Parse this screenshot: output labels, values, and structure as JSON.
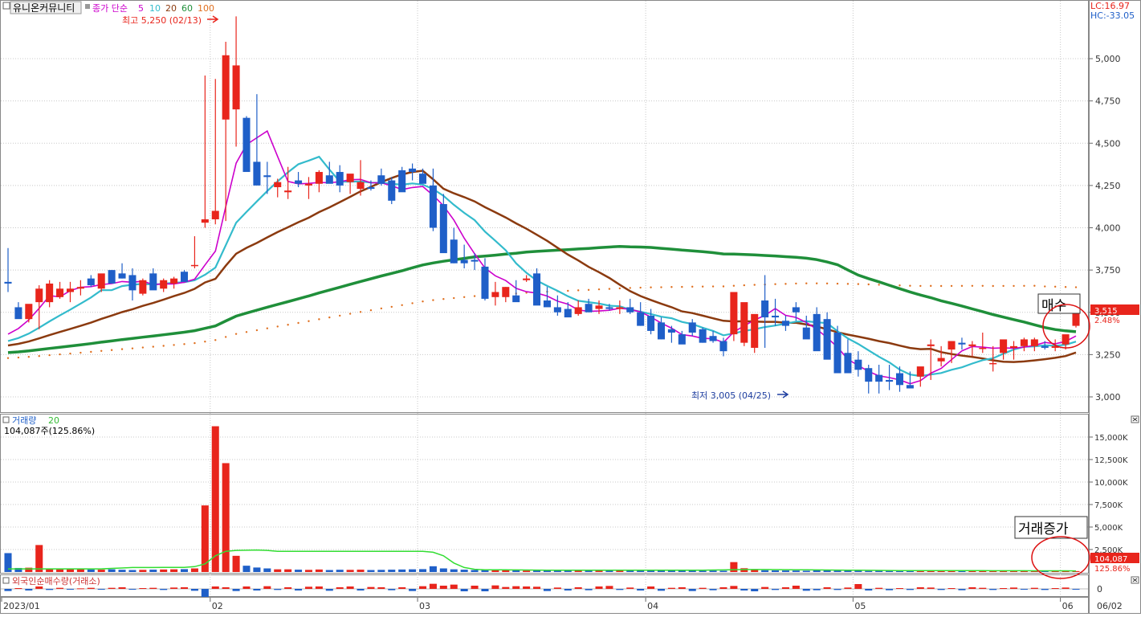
{
  "stock_name": "유니온커뮤니티",
  "price_panel": {
    "indicator_label": "종가 단순",
    "ma_periods": [
      {
        "label": "5",
        "color": "#cc00cc"
      },
      {
        "label": "10",
        "color": "#33bbcc"
      },
      {
        "label": "20",
        "color": "#8b3a0f"
      },
      {
        "label": "60",
        "color": "#1f8f3a"
      },
      {
        "label": "100",
        "color": "#e07020"
      }
    ],
    "lc_label": "LC:16.97",
    "hc_label": "HC:-33.05",
    "high_annotation": "최고 5,250 (02/13)",
    "low_annotation": "최저 3,005 (04/25)",
    "current_price": "3,515",
    "current_change": "2.48%",
    "buy_label": "매수",
    "y_ticks": [
      "5,000",
      "4,750",
      "4,500",
      "4,250",
      "4,000",
      "3,750",
      "3,500",
      "3,250",
      "3,000"
    ]
  },
  "volume_panel": {
    "title": "거래량",
    "ma_label": "20",
    "info": "104,087주(125.86%)",
    "current_volume": "104,087",
    "current_ratio": "125.86%",
    "increase_label": "거래증가",
    "y_ticks": [
      "15,000K",
      "12,500K",
      "10,000K",
      "7,500K",
      "5,000K",
      "2,500K"
    ]
  },
  "foreign_panel": {
    "title": "외국인순매수량(거래소)",
    "zero_tick": "0"
  },
  "x_axis": {
    "labels": [
      "2023/01",
      "02",
      "03",
      "04",
      "05",
      "06"
    ],
    "last_date": "06/02"
  },
  "colors": {
    "up": "#e8251c",
    "down": "#1f5fc8",
    "vol_ma": "#33dd33",
    "grid": "#c8c8c8",
    "axis_text": "#333333"
  },
  "chart_data": {
    "type": "candlestick",
    "dates": [
      "01/02",
      "01/03",
      "01/04",
      "01/05",
      "01/06",
      "01/09",
      "01/10",
      "01/11",
      "01/12",
      "01/13",
      "01/16",
      "01/17",
      "01/18",
      "01/19",
      "01/20",
      "01/25",
      "01/26",
      "01/27",
      "01/30",
      "01/31",
      "02/01",
      "02/02",
      "02/03",
      "02/06",
      "02/07",
      "02/08",
      "02/09",
      "02/10",
      "02/13",
      "02/14",
      "02/15",
      "02/16",
      "02/17",
      "02/20",
      "02/21",
      "02/22",
      "02/23",
      "02/24",
      "02/27",
      "02/28",
      "03/02",
      "03/03",
      "03/06",
      "03/07",
      "03/08",
      "03/09",
      "03/10",
      "03/13",
      "03/14",
      "03/15",
      "03/16",
      "03/17",
      "03/20",
      "03/21",
      "03/22",
      "03/23",
      "03/24",
      "03/27",
      "03/28",
      "03/29",
      "03/30",
      "03/31",
      "04/03",
      "04/04",
      "04/05",
      "04/06",
      "04/07",
      "04/10",
      "04/11",
      "04/12",
      "04/13",
      "04/14",
      "04/17",
      "04/18",
      "04/19",
      "04/20",
      "04/21",
      "04/24",
      "04/25",
      "04/26",
      "04/27",
      "04/28",
      "05/02",
      "05/03",
      "05/04",
      "05/08",
      "05/09",
      "05/10",
      "05/11",
      "05/12",
      "05/15",
      "05/16",
      "05/17",
      "05/18",
      "05/19",
      "05/22",
      "05/23",
      "05/24",
      "05/25",
      "05/26",
      "05/30",
      "05/31",
      "06/01",
      "06/02"
    ],
    "open": [
      3680,
      3530,
      3460,
      3560,
      3560,
      3590,
      3620,
      3640,
      3700,
      3640,
      3750,
      3730,
      3720,
      3610,
      3730,
      3640,
      3670,
      3740,
      3780,
      4030,
      4050,
      4640,
      4700,
      4650,
      4390,
      4310,
      4240,
      4210,
      4280,
      4250,
      4260,
      4310,
      4330,
      4270,
      4230,
      4240,
      4310,
      4280,
      4340,
      4350,
      4320,
      4250,
      4140,
      3930,
      3810,
      3810,
      3770,
      3590,
      3590,
      3600,
      3690,
      3730,
      3570,
      3530,
      3520,
      3490,
      3550,
      3520,
      3530,
      3520,
      3530,
      3500,
      3480,
      3440,
      3400,
      3370,
      3440,
      3400,
      3360,
      3330,
      3370,
      3320,
      3290,
      3570,
      3480,
      3450,
      3530,
      3410,
      3490,
      3460,
      3380,
      3260,
      3220,
      3170,
      3130,
      3100,
      3140,
      3070,
      3120,
      3300,
      3210,
      3280,
      3320,
      3300,
      3290,
      3200,
      3260,
      3290,
      3300,
      3300,
      3300,
      3290,
      3310,
      3420
    ],
    "high": [
      3880,
      3560,
      3540,
      3660,
      3690,
      3680,
      3680,
      3690,
      3720,
      3720,
      3750,
      3790,
      3760,
      3700,
      3760,
      3700,
      3710,
      3750,
      3950,
      4900,
      4880,
      5100,
      5250,
      4660,
      4790,
      4390,
      4290,
      4360,
      4330,
      4300,
      4340,
      4390,
      4370,
      4310,
      4400,
      4280,
      4350,
      4300,
      4360,
      4380,
      4350,
      4350,
      4200,
      4000,
      3900,
      3850,
      3820,
      3680,
      3650,
      3690,
      3720,
      3760,
      3650,
      3600,
      3560,
      3570,
      3580,
      3570,
      3550,
      3570,
      3580,
      3560,
      3520,
      3470,
      3420,
      3390,
      3460,
      3410,
      3390,
      3350,
      3400,
      3380,
      3360,
      3720,
      3580,
      3480,
      3560,
      3480,
      3530,
      3500,
      3420,
      3340,
      3270,
      3190,
      3190,
      3190,
      3180,
      3150,
      3170,
      3340,
      3300,
      3330,
      3350,
      3330,
      3380,
      3300,
      3320,
      3330,
      3350,
      3350,
      3330,
      3340,
      3350,
      3420
    ],
    "low": [
      3620,
      3470,
      3440,
      3400,
      3530,
      3580,
      3560,
      3600,
      3650,
      3620,
      3690,
      3700,
      3570,
      3600,
      3700,
      3620,
      3640,
      3700,
      3760,
      4000,
      4020,
      4040,
      4480,
      4480,
      4320,
      4200,
      4180,
      4170,
      4240,
      4170,
      4210,
      4280,
      4210,
      4200,
      4190,
      4220,
      4250,
      4140,
      4250,
      4280,
      4280,
      3980,
      3920,
      3790,
      3760,
      3750,
      3570,
      3540,
      3560,
      3570,
      3680,
      3600,
      3550,
      3480,
      3480,
      3480,
      3510,
      3490,
      3510,
      3490,
      3490,
      3420,
      3370,
      3340,
      3320,
      3340,
      3360,
      3320,
      3320,
      3240,
      3330,
      3300,
      3260,
      3290,
      3420,
      3390,
      3450,
      3380,
      3420,
      3430,
      3300,
      3200,
      3120,
      3020,
      3020,
      3040,
      3030,
      3050,
      3060,
      3100,
      3180,
      3200,
      3280,
      3240,
      3260,
      3150,
      3220,
      3220,
      3270,
      3270,
      3280,
      3270,
      3280,
      3410
    ],
    "close": [
      3670,
      3460,
      3550,
      3640,
      3670,
      3640,
      3640,
      3650,
      3660,
      3730,
      3670,
      3700,
      3630,
      3690,
      3630,
      3690,
      3700,
      3680,
      3780,
      4050,
      4100,
      5020,
      4960,
      4330,
      4250,
      4300,
      4270,
      4220,
      4260,
      4260,
      4330,
      4260,
      4250,
      4320,
      4270,
      4230,
      4260,
      4160,
      4210,
      4330,
      4260,
      4000,
      3850,
      3790,
      3790,
      3800,
      3580,
      3620,
      3650,
      3560,
      3700,
      3540,
      3530,
      3500,
      3470,
      3530,
      3500,
      3540,
      3520,
      3530,
      3500,
      3420,
      3390,
      3340,
      3380,
      3310,
      3380,
      3320,
      3330,
      3270,
      3620,
      3560,
      3490,
      3470,
      3470,
      3420,
      3500,
      3340,
      3270,
      3220,
      3140,
      3140,
      3160,
      3090,
      3090,
      3090,
      3070,
      3050,
      3180,
      3310,
      3230,
      3330,
      3310,
      3310,
      3290,
      3200,
      3340,
      3300,
      3340,
      3340,
      3290,
      3300,
      3370,
      3500
    ],
    "volume_k": [
      2100,
      450,
      480,
      3000,
      350,
      300,
      380,
      320,
      280,
      260,
      300,
      250,
      220,
      240,
      260,
      280,
      300,
      320,
      400,
      7400,
      16200,
      12100,
      1800,
      700,
      500,
      400,
      300,
      300,
      260,
      240,
      280,
      220,
      250,
      240,
      260,
      220,
      240,
      260,
      280,
      300,
      320,
      640,
      400,
      300,
      260,
      220,
      240,
      260,
      200,
      180,
      160,
      200,
      180,
      160,
      150,
      150,
      160,
      150,
      140,
      150,
      160,
      150,
      150,
      140,
      150,
      140,
      140,
      130,
      160,
      140,
      1100,
      420,
      260,
      200,
      180,
      170,
      160,
      140,
      200,
      180,
      160,
      140,
      130,
      120,
      140,
      130,
      120,
      130,
      120,
      140,
      150,
      130,
      150,
      140,
      130,
      120,
      110,
      120,
      130,
      120,
      110,
      130,
      120,
      104
    ],
    "volume_ma_k": [
      350,
      350,
      350,
      350,
      350,
      350,
      350,
      350,
      350,
      350,
      400,
      450,
      500,
      500,
      500,
      520,
      520,
      520,
      600,
      900,
      1800,
      2300,
      2400,
      2420,
      2450,
      2400,
      2300,
      2300,
      2300,
      2300,
      2300,
      2300,
      2300,
      2300,
      2300,
      2300,
      2300,
      2300,
      2300,
      2300,
      2300,
      2200,
      1800,
      1000,
      500,
      300,
      250,
      250,
      240,
      230,
      220,
      210,
      200,
      200,
      200,
      200,
      200,
      200,
      200,
      200,
      200,
      200,
      200,
      200,
      200,
      200,
      200,
      200,
      220,
      230,
      260,
      280,
      280,
      280,
      270,
      260,
      250,
      240,
      230,
      220,
      210,
      200,
      200,
      190,
      180,
      170,
      160,
      160,
      150,
      150,
      150,
      150,
      150,
      150,
      150,
      140,
      140,
      140,
      140,
      130,
      130,
      130,
      130,
      125
    ],
    "foreign_net_k": [
      -80,
      30,
      -60,
      90,
      -40,
      40,
      -30,
      20,
      40,
      -20,
      40,
      60,
      -30,
      30,
      40,
      -40,
      50,
      60,
      -70,
      -300,
      90,
      60,
      -80,
      90,
      -60,
      100,
      -40,
      60,
      -60,
      80,
      90,
      -70,
      60,
      90,
      -60,
      70,
      60,
      -50,
      60,
      -80,
      100,
      190,
      120,
      160,
      -90,
      120,
      -90,
      130,
      70,
      100,
      90,
      80,
      -80,
      50,
      -60,
      60,
      -50,
      90,
      110,
      -40,
      50,
      -60,
      90,
      -70,
      40,
      60,
      -80,
      40,
      -50,
      60,
      110,
      -60,
      -90,
      70,
      -40,
      60,
      120,
      -70,
      -50,
      60,
      -40,
      50,
      180,
      -60,
      40,
      -50,
      30,
      -40,
      60,
      50,
      -40,
      30,
      -50,
      60,
      40,
      -40,
      30,
      50,
      -30,
      40,
      -40,
      30,
      50,
      -30
    ],
    "ma5_start": 3520,
    "ylim_price": [
      2900,
      5300
    ],
    "ylim_volume_k": [
      0,
      17500
    ]
  }
}
